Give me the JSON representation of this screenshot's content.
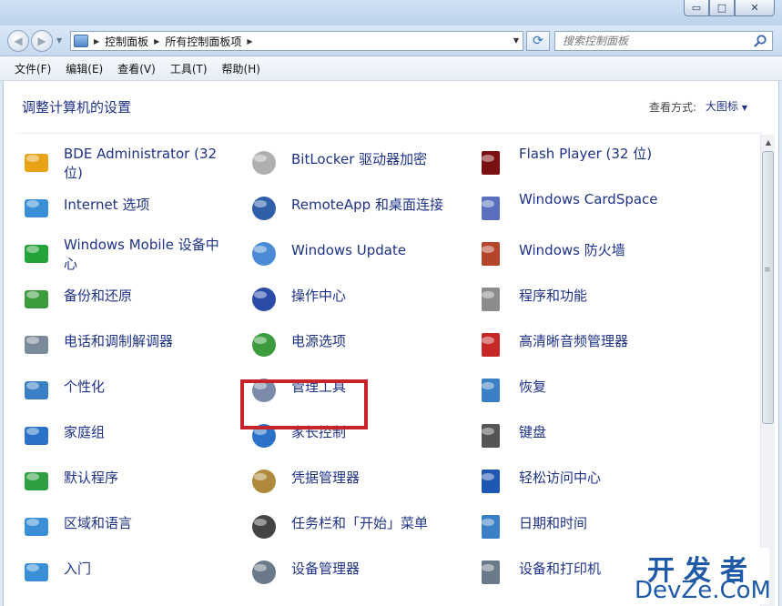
{
  "window": {
    "minimize": "▭",
    "maximize": "□",
    "close": "✕"
  },
  "address": {
    "crumbs": [
      "控制面板",
      "所有控制面板项"
    ]
  },
  "search": {
    "placeholder": "搜索控制面板"
  },
  "menu": [
    "文件(F)",
    "编辑(E)",
    "查看(V)",
    "工具(T)",
    "帮助(H)"
  ],
  "header": {
    "title": "调整计算机的设置",
    "view_label": "查看方式:",
    "view_value": "大图标"
  },
  "items": [
    {
      "label": "BDE Administrator (32 位)",
      "icon": "bde-admin-icon",
      "color": "#e8a317"
    },
    {
      "label": "BitLocker 驱动器加密",
      "icon": "bitlocker-key-icon",
      "color": "#b0b0b0"
    },
    {
      "label": "Flash Player (32 位)",
      "icon": "flash-player-icon",
      "color": "#7a1010"
    },
    {
      "label": "Internet 选项",
      "icon": "internet-options-icon",
      "color": "#3b8fd6"
    },
    {
      "label": "RemoteApp 和桌面连接",
      "icon": "remoteapp-icon",
      "color": "#2f5fa8"
    },
    {
      "label": "Windows CardSpace",
      "icon": "cardspace-icon",
      "color": "#5b6fbf"
    },
    {
      "label": "Windows Mobile 设备中心",
      "icon": "mobile-device-center-icon",
      "color": "#23a33a"
    },
    {
      "label": "Windows Update",
      "icon": "windows-update-icon",
      "color": "#4b8bd6"
    },
    {
      "label": "Windows 防火墙",
      "icon": "firewall-icon",
      "color": "#b5452a"
    },
    {
      "label": "备份和还原",
      "icon": "backup-restore-icon",
      "color": "#3c9b3c"
    },
    {
      "label": "操作中心",
      "icon": "action-center-flag-icon",
      "color": "#2a4ca8"
    },
    {
      "label": "程序和功能",
      "icon": "programs-features-icon",
      "color": "#8c8c8c"
    },
    {
      "label": "电话和调制解调器",
      "icon": "phone-modem-icon",
      "color": "#7a8a9a"
    },
    {
      "label": "电源选项",
      "icon": "power-options-icon",
      "color": "#3c9b3c"
    },
    {
      "label": "高清晰音频管理器",
      "icon": "audio-manager-icon",
      "color": "#c62828"
    },
    {
      "label": "个性化",
      "icon": "personalization-icon",
      "color": "#3b7fc4"
    },
    {
      "label": "管理工具",
      "icon": "admin-tools-icon",
      "color": "#7a8aa8"
    },
    {
      "label": "恢复",
      "icon": "recovery-icon",
      "color": "#3b7fc4"
    },
    {
      "label": "家庭组",
      "icon": "homegroup-icon",
      "color": "#2a73c9"
    },
    {
      "label": "家长控制",
      "icon": "parental-controls-icon",
      "color": "#2a73c9"
    },
    {
      "label": "键盘",
      "icon": "keyboard-icon",
      "color": "#555555"
    },
    {
      "label": "默认程序",
      "icon": "default-programs-icon",
      "color": "#2ea043"
    },
    {
      "label": "凭据管理器",
      "icon": "credential-manager-icon",
      "color": "#b08a3c"
    },
    {
      "label": "轻松访问中心",
      "icon": "ease-of-access-icon",
      "color": "#1f57b5"
    },
    {
      "label": "区域和语言",
      "icon": "region-language-icon",
      "color": "#3b8fd6"
    },
    {
      "label": "任务栏和「开始」菜单",
      "icon": "taskbar-start-icon",
      "color": "#444444"
    },
    {
      "label": "日期和时间",
      "icon": "date-time-icon",
      "color": "#3b7fc4"
    },
    {
      "label": "入门",
      "icon": "getting-started-icon",
      "color": "#3b8fd6"
    },
    {
      "label": "设备管理器",
      "icon": "device-manager-icon",
      "color": "#6a7a8a"
    },
    {
      "label": "设备和打印机",
      "icon": "devices-printers-icon",
      "color": "#6a7a8a"
    }
  ],
  "highlighted_item": "管理工具",
  "watermark": {
    "cn": "开发者",
    "en": "DevZe.CoM"
  },
  "colors": {
    "link": "#1e3287",
    "highlight": "#c6232b"
  }
}
